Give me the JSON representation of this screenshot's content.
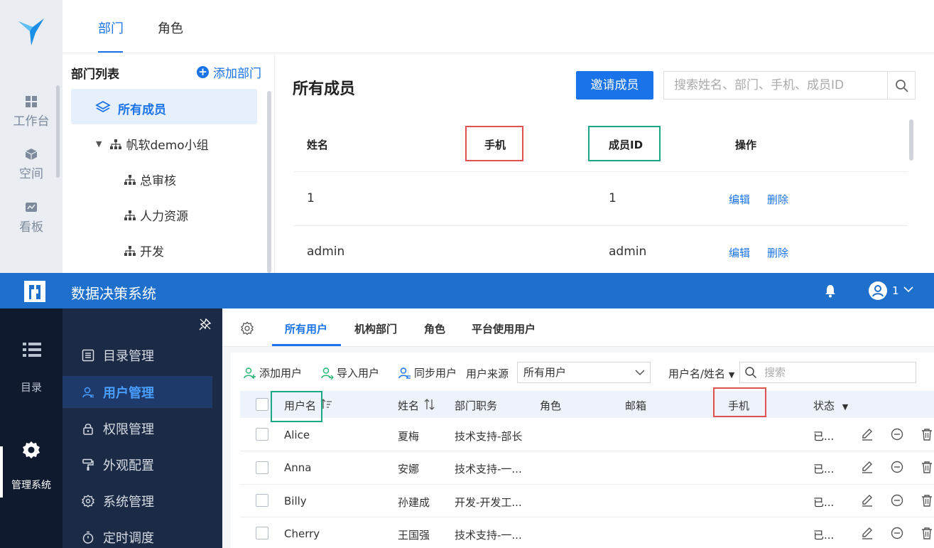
{
  "top": {
    "rail": {
      "items": [
        {
          "label": "工作台",
          "icon": "grid-icon"
        },
        {
          "label": "空间",
          "icon": "cube-icon"
        },
        {
          "label": "看板",
          "icon": "chart-board-icon"
        }
      ]
    },
    "tabs": [
      {
        "label": "部门",
        "active": true
      },
      {
        "label": "角色",
        "active": false
      }
    ],
    "dept_list": {
      "title": "部门列表",
      "add_label": "添加部门",
      "all_members": "所有成员",
      "tree": [
        {
          "label": "帆软demo小组",
          "expandable": true
        },
        {
          "label": "总审核"
        },
        {
          "label": "人力资源"
        },
        {
          "label": "开发"
        }
      ]
    },
    "members": {
      "title": "所有成员",
      "invite_label": "邀请成员",
      "search_placeholder": "搜索姓名、部门、手机、成员ID",
      "columns": [
        "姓名",
        "手机",
        "成员ID",
        "操作"
      ],
      "rows": [
        {
          "name": "1",
          "phone": "",
          "id": "1",
          "edit": "编辑",
          "delete": "删除"
        },
        {
          "name": "admin",
          "phone": "",
          "id": "admin",
          "edit": "编辑",
          "delete": "删除"
        }
      ]
    }
  },
  "bottom": {
    "app_title": "数据决策系统",
    "user_name": "1",
    "rail": {
      "catalog_label": "目录",
      "admin_label": "管理系统"
    },
    "menu": [
      {
        "label": "目录管理",
        "icon": "list-icon",
        "active": false
      },
      {
        "label": "用户管理",
        "icon": "user-icon",
        "active": true
      },
      {
        "label": "权限管理",
        "icon": "lock-icon",
        "active": false
      },
      {
        "label": "外观配置",
        "icon": "paint-roller-icon",
        "active": false
      },
      {
        "label": "系统管理",
        "icon": "gear-icon",
        "active": false
      },
      {
        "label": "定时调度",
        "icon": "timer-icon",
        "active": false
      }
    ],
    "sub_tabs": [
      {
        "label": "所有用户",
        "active": true
      },
      {
        "label": "机构部门",
        "active": false
      },
      {
        "label": "角色",
        "active": false
      },
      {
        "label": "平台使用用户",
        "active": false
      }
    ],
    "toolbar": {
      "add_user": "添加用户",
      "import_user": "导入用户",
      "sync_user": "同步用户",
      "source_label": "用户来源",
      "source_value": "所有用户",
      "field_select": "用户名/姓名",
      "search_placeholder": "搜索"
    },
    "table": {
      "columns": [
        "用户名",
        "姓名",
        "部门职务",
        "角色",
        "邮箱",
        "手机",
        "状态"
      ],
      "rows": [
        {
          "username": "Alice",
          "name": "夏梅",
          "dept": "技术支持-部长",
          "status": "已..."
        },
        {
          "username": "Anna",
          "name": "安娜",
          "dept": "技术支持-一...",
          "status": "已..."
        },
        {
          "username": "Billy",
          "name": "孙建成",
          "dept": "开发-开发工...",
          "status": "已..."
        },
        {
          "username": "Cherry",
          "name": "王国强",
          "dept": "技术支持-一...",
          "status": "已..."
        }
      ]
    }
  },
  "colors": {
    "accent": "#1a73e8",
    "app_bar": "#1f6fcc",
    "dark_rail": "#0f1a2e",
    "menu_panel": "#1c2b45",
    "highlight_red": "#e05252",
    "highlight_green": "#1aa886"
  }
}
